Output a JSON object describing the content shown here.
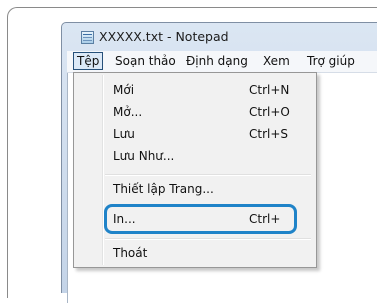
{
  "window": {
    "title": "XXXXX.txt - Notepad",
    "icon": "notepad-icon"
  },
  "menubar": {
    "items": [
      {
        "label": "Tệp"
      },
      {
        "label": "Soạn thảo"
      },
      {
        "label": "Định dạng"
      },
      {
        "label": "Xem"
      },
      {
        "label": "Trợ giúp"
      }
    ]
  },
  "file_menu": {
    "items": [
      {
        "label": "Mới",
        "shortcut": "Ctrl+N"
      },
      {
        "label": "Mở...",
        "shortcut": "Ctrl+O"
      },
      {
        "label": "Lưu",
        "shortcut": "Ctrl+S"
      },
      {
        "label": "Lưu Như..."
      },
      {
        "label": "Thiết lập Trang..."
      },
      {
        "label": "In...",
        "shortcut": "Ctrl+"
      },
      {
        "label": "Thoát"
      }
    ]
  },
  "colors": {
    "highlight_outline": "#1f83c8",
    "active_menu_border": "#26507a"
  }
}
